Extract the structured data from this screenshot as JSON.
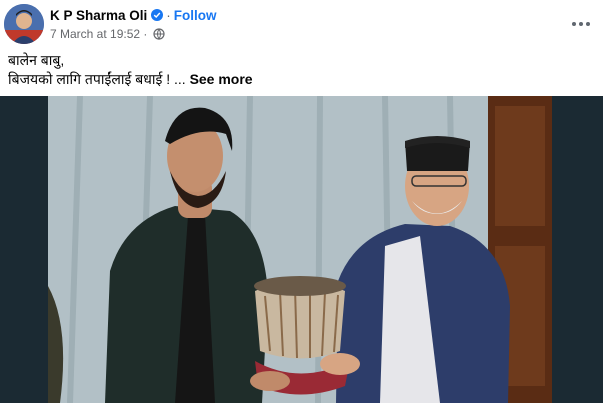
{
  "post": {
    "author": "K P Sharma Oli",
    "separator": "·",
    "follow_label": "Follow",
    "timestamp": "7 March at 19:52",
    "timestamp_sep": "·",
    "caption_line1": "बालेन बाबु,",
    "caption_line2": "बिजयको लागि तपाईंलाई बधाई !",
    "ellipsis": "...",
    "see_more_label": "See more",
    "icons": {
      "verified": "verified-badge-icon",
      "privacy": "globe-icon",
      "more": "more-options-icon"
    }
  },
  "colors": {
    "accent": "#1877f2",
    "text_primary": "#050505",
    "text_secondary": "#65676b"
  }
}
